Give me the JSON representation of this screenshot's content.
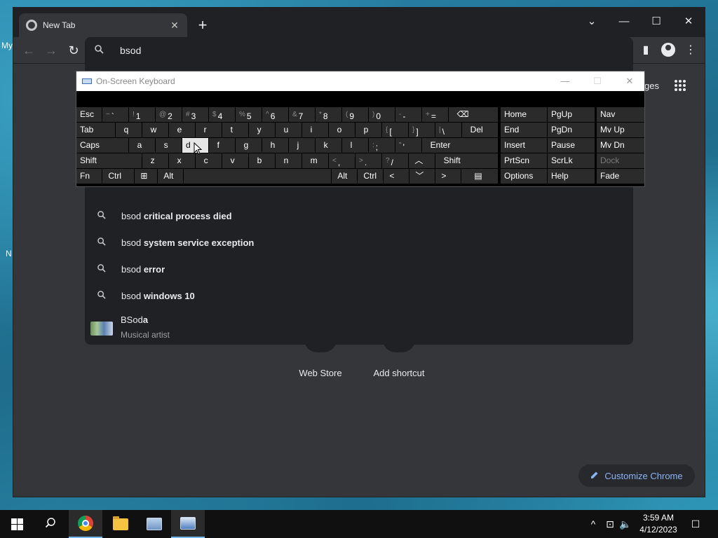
{
  "desktop": {
    "fragment_my": "My",
    "fragment_n": "N"
  },
  "chrome": {
    "tab_title": "New Tab",
    "tab_close": "✕",
    "new_tab": "+",
    "win_controls": {
      "chevron": "⌄",
      "minimize": "—",
      "maximize": "☐",
      "close": "✕"
    },
    "nav": {
      "back": "←",
      "forward": "→",
      "reload": "↻"
    },
    "omnibox": {
      "icon": "search-icon",
      "value": "bsod"
    },
    "toolbar_right": {
      "sidepanel": "▮",
      "menu": "⋮"
    },
    "images_link": "ges",
    "apps_icon": "⋮⋮⋮"
  },
  "suggestions": [
    {
      "prefix": "bsod",
      "bold": " critical process died"
    },
    {
      "prefix": "bsod",
      "bold": " system service exception"
    },
    {
      "prefix": "bsod",
      "bold": " error"
    },
    {
      "prefix": "bsod",
      "bold": " windows 10"
    }
  ],
  "entity": {
    "title_prefix": "BSod",
    "title_bold": "a",
    "subtitle": "Musical artist"
  },
  "shortcuts": [
    {
      "label": "Web Store"
    },
    {
      "label": "Add shortcut"
    }
  ],
  "customize": {
    "icon": "pencil-icon",
    "label": "Customize Chrome"
  },
  "osk": {
    "title": "On-Screen Keyboard",
    "controls": {
      "minimize": "—",
      "maximize": "☐",
      "close": "✕"
    },
    "pressed_key": "d"
  },
  "taskbar": {
    "time": "3:59 AM",
    "date": "4/12/2023",
    "tray": {
      "chevron": "^",
      "network": "⊡",
      "volume": "🔈",
      "notifications": "☐"
    }
  }
}
